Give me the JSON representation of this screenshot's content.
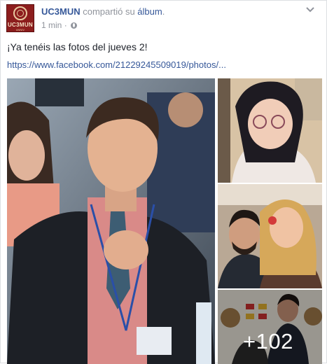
{
  "post": {
    "page_name": "UC3MUN",
    "action_text": "compartió su",
    "album_link": "álbum",
    "trailing_punct": ".",
    "time": "1 min",
    "separator": "·",
    "privacy_icon": "globe-icon",
    "menu_icon": "chevron-down-icon",
    "status_text": "¡Ya tenéis las fotos del jueves 2!",
    "link_text": "https://www.facebook.com/21229245509019/photos/..."
  },
  "avatar": {
    "logo_text": "UC3MUN",
    "logo_subtext": "ANNIV"
  },
  "gallery": {
    "more_count": "+102"
  },
  "colors": {
    "link_blue": "#365899",
    "meta_gray": "#90949c",
    "text": "#1d2129",
    "logo_red": "#8c1d1d"
  }
}
